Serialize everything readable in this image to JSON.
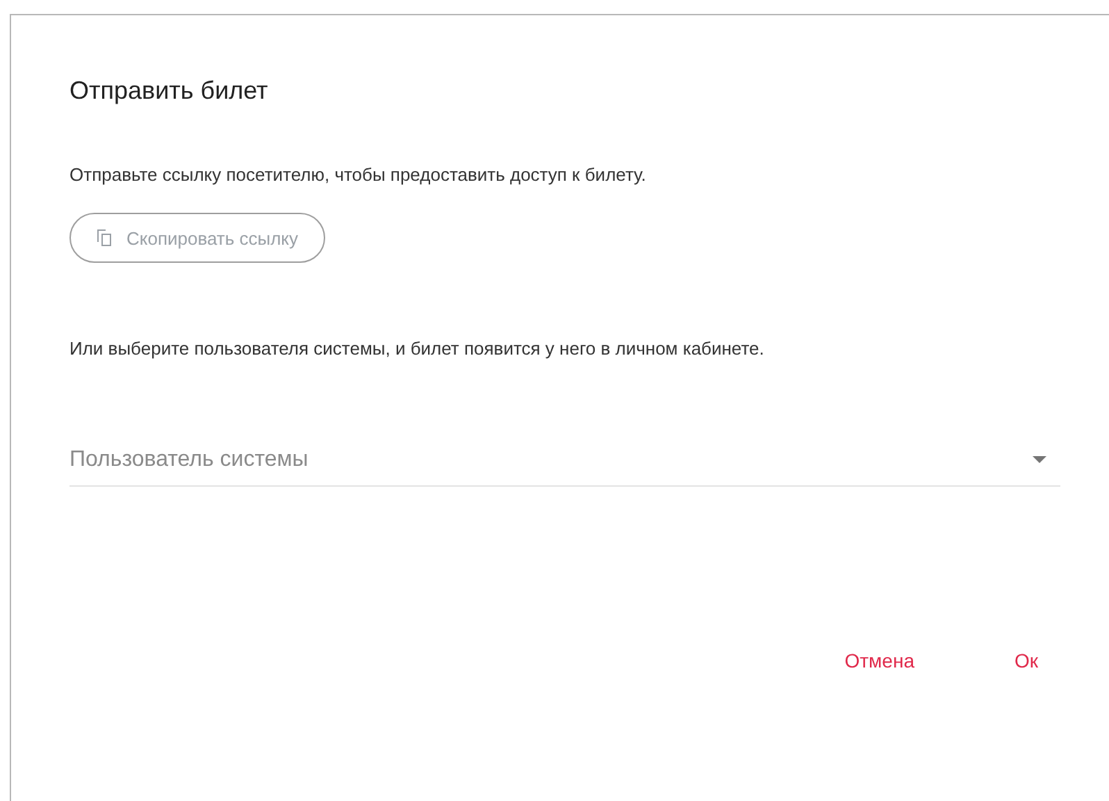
{
  "dialog": {
    "title": "Отправить билет",
    "link_text": "Отправьте ссылку посетителю, чтобы предоставить доступ к билету.",
    "copy_button": "Скопировать ссылку",
    "user_text": "Или выберите пользователя системы, и билет появится у него в личном кабинете.",
    "user_select": {
      "placeholder": "Пользователь системы"
    },
    "buttons": [
      "Отмена",
      "Ок"
    ]
  }
}
